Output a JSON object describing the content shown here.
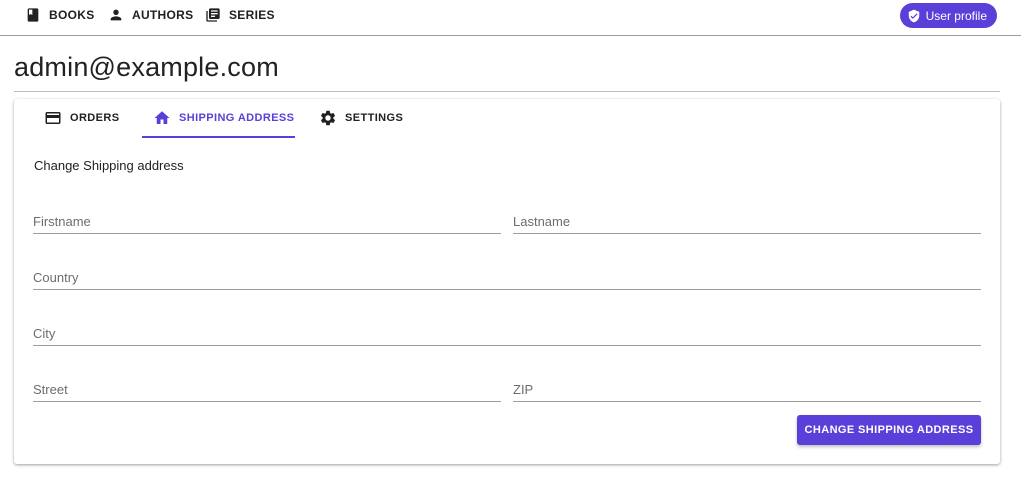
{
  "nav": {
    "items": [
      {
        "label": "BOOKS",
        "icon": "book-icon"
      },
      {
        "label": "AUTHORS",
        "icon": "person-icon"
      },
      {
        "label": "SERIES",
        "icon": "library-icon"
      }
    ],
    "user_button": {
      "label": "User profile",
      "icon": "shield-check-icon"
    }
  },
  "page": {
    "title": "admin@example.com"
  },
  "tabs": [
    {
      "label": "ORDERS",
      "icon": "credit-card-icon",
      "active": false
    },
    {
      "label": "SHIPPING ADDRESS",
      "icon": "home-icon",
      "active": true
    },
    {
      "label": "SETTINGS",
      "icon": "gear-icon",
      "active": false
    }
  ],
  "form": {
    "heading": "Change Shipping address",
    "fields": {
      "firstname": {
        "placeholder": "Firstname",
        "value": ""
      },
      "lastname": {
        "placeholder": "Lastname",
        "value": ""
      },
      "country": {
        "placeholder": "Country",
        "value": ""
      },
      "city": {
        "placeholder": "City",
        "value": ""
      },
      "street": {
        "placeholder": "Street",
        "value": ""
      },
      "zip": {
        "placeholder": "ZIP",
        "value": ""
      }
    },
    "submit_label": "CHANGE SHIPPING ADDRESS"
  },
  "colors": {
    "accent": "#5b3fd8",
    "text": "#212121",
    "divider": "#9e9e9e"
  }
}
